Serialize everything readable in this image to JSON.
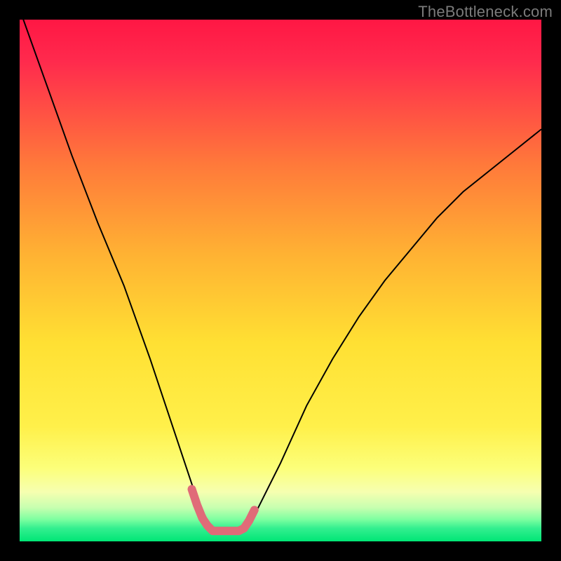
{
  "watermark": "TheBottleneck.com",
  "chart_data": {
    "type": "line",
    "title": "",
    "xlabel": "",
    "ylabel": "",
    "xlim": [
      0,
      100
    ],
    "ylim": [
      0,
      100
    ],
    "gradient_stops": [
      {
        "offset": 0.0,
        "color": "#ff1744"
      },
      {
        "offset": 0.08,
        "color": "#ff2a4d"
      },
      {
        "offset": 0.28,
        "color": "#ff7a3a"
      },
      {
        "offset": 0.45,
        "color": "#ffb233"
      },
      {
        "offset": 0.62,
        "color": "#ffe033"
      },
      {
        "offset": 0.78,
        "color": "#fff04a"
      },
      {
        "offset": 0.86,
        "color": "#fcff7a"
      },
      {
        "offset": 0.905,
        "color": "#f6ffb0"
      },
      {
        "offset": 0.935,
        "color": "#c8ffb0"
      },
      {
        "offset": 0.958,
        "color": "#7dffa0"
      },
      {
        "offset": 0.975,
        "color": "#33ef8f"
      },
      {
        "offset": 1.0,
        "color": "#00e676"
      }
    ],
    "series": [
      {
        "name": "bottleneck-curve",
        "color": "#000000",
        "stroke_width": 2,
        "x": [
          0,
          5,
          10,
          15,
          20,
          25,
          28,
          30,
          32,
          34,
          35,
          36,
          37,
          38,
          39,
          40,
          41,
          42,
          43,
          44,
          45,
          47,
          50,
          55,
          60,
          65,
          70,
          75,
          80,
          85,
          90,
          95,
          100
        ],
        "values": [
          102,
          88,
          74,
          61,
          49,
          35,
          26,
          20,
          14,
          8,
          6,
          4,
          2.5,
          2,
          2,
          2,
          2,
          2,
          2.5,
          3.5,
          5,
          9,
          15,
          26,
          35,
          43,
          50,
          56,
          62,
          67,
          71,
          75,
          79
        ]
      },
      {
        "name": "valley-highlight",
        "color": "#e06b78",
        "stroke_width": 12,
        "linecap": "round",
        "x": [
          33,
          34,
          35,
          36,
          37,
          38,
          39,
          40,
          41,
          42,
          43,
          44,
          45
        ],
        "values": [
          10,
          7,
          4.5,
          3,
          2,
          2,
          2,
          2,
          2,
          2,
          2.5,
          4,
          6
        ]
      }
    ]
  }
}
